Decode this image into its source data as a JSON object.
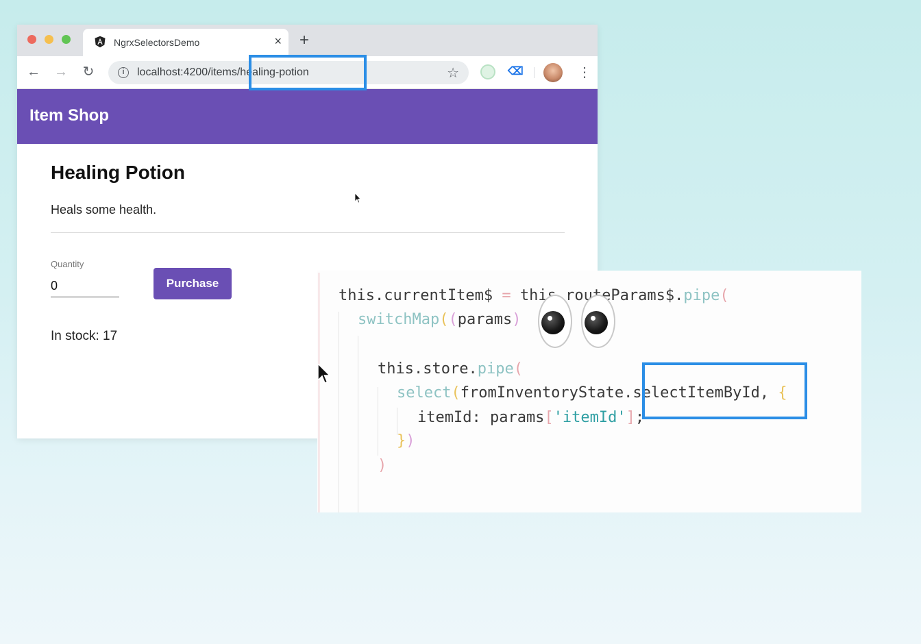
{
  "browser": {
    "tab": {
      "title": "NgrxSelectorsDemo",
      "close_glyph": "×"
    },
    "new_tab_glyph": "+",
    "nav": {
      "back": "←",
      "forward": "→",
      "reload": "↻"
    },
    "url": "localhost:4200/items/healing-potion",
    "info_glyph": "i",
    "star_glyph": "☆",
    "menu_glyph": "⋮",
    "ext_glyph": "⌫",
    "icons": [
      "angular-icon",
      "back-arrow-icon",
      "forward-arrow-icon",
      "reload-icon",
      "info-icon",
      "star-icon",
      "extension-icon",
      "avatar",
      "menu-dots-icon"
    ]
  },
  "app": {
    "title": "Item Shop",
    "item": {
      "name": "Healing Potion",
      "description": "Heals some health.",
      "quantity_label": "Quantity",
      "quantity_value": "0",
      "purchase_label": "Purchase",
      "stock_text": "In stock: 17"
    }
  },
  "code": {
    "line1": {
      "a": "this.currentItem$ ",
      "op": "=",
      "b": " this.routeParams$.",
      "fn": "pipe",
      "p": "("
    },
    "line2": {
      "fn": "switchMap",
      "p1": "(",
      "p2": "(",
      "b": "params",
      "p3": ")"
    },
    "line3": {
      "a": "this.store.",
      "fn": "pipe",
      "p": "("
    },
    "line4": {
      "fn": "select",
      "p": "(",
      "b": "fromInventoryState.selectItemById, ",
      "p2": "{"
    },
    "line5": {
      "a": "itemId: params",
      "p1": "[",
      "s": "'itemId'",
      "p2": "]",
      "c": ";"
    },
    "line6": {
      "a": "}",
      "p": ")"
    },
    "line7": {
      "p": ")"
    }
  },
  "emoji": "eyes-emoji",
  "colors": {
    "app_bar": "#6a4fb4",
    "highlight": "#2b8ee6",
    "background_top": "#c6ecec"
  }
}
